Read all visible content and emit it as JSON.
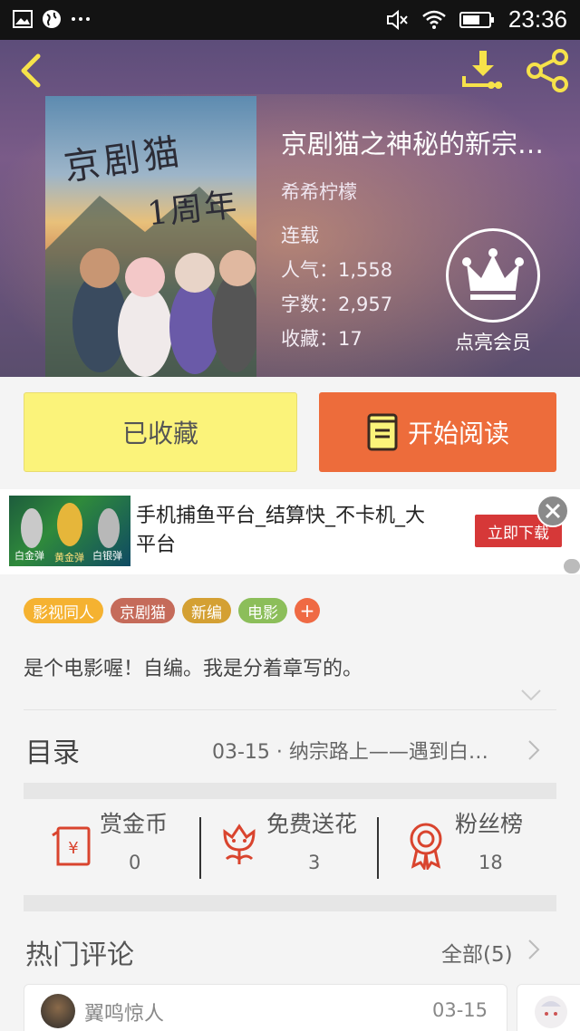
{
  "status_bar": {
    "time": "23:36"
  },
  "book": {
    "title": "京剧猫之神秘的新宗…",
    "author": "希希柠檬",
    "status": "连载",
    "popularity_label": "人气：",
    "popularity": "1,558",
    "words_label": "字数：",
    "words": "2,957",
    "favorites_label": "收藏：",
    "favorites": "17",
    "cover_title": "京剧猫",
    "cover_subtitle": "1周年"
  },
  "vip": {
    "label": "点亮会员"
  },
  "actions": {
    "collected": "已收藏",
    "start_reading": "开始阅读"
  },
  "ad": {
    "text": "手机捕鱼平台_结算快_不卡机_大平台",
    "button": "立即下载",
    "image_labels": [
      "白金弹",
      "黄金弹",
      "白银弹"
    ]
  },
  "tags": [
    {
      "label": "影视同人",
      "color": "#f5b231"
    },
    {
      "label": "京剧猫",
      "color": "#c56b5a"
    },
    {
      "label": "新编",
      "color": "#d4a033"
    },
    {
      "label": "电影",
      "color": "#8cbe5a"
    }
  ],
  "tag_more": "+",
  "description": "是个电影喔！自编。我是分着章写的。",
  "toc": {
    "label": "目录",
    "latest": "03-15 · 纳宗路上——遇到白…"
  },
  "stats": [
    {
      "label": "赏金币",
      "value": "0"
    },
    {
      "label": "免费送花",
      "value": "3"
    },
    {
      "label": "粉丝榜",
      "value": "18"
    }
  ],
  "hot_comments": {
    "label": "热门评论",
    "all": "全部(5)",
    "items": [
      {
        "user": "翼鸣惊人",
        "date": "03-15"
      }
    ]
  },
  "colors": {
    "accent": "#ed6c3b",
    "collect_bg": "#fbf37a",
    "icon_yellow": "#f6e24a",
    "icon_red": "#d9442e"
  }
}
